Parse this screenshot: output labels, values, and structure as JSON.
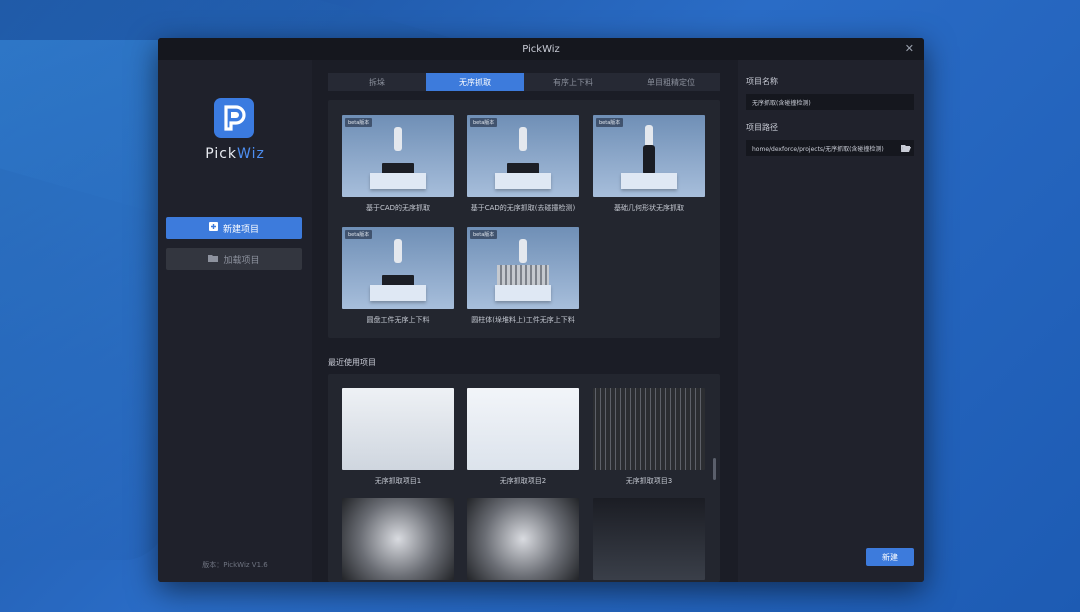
{
  "window": {
    "title": "PickWiz"
  },
  "sidebar": {
    "logo_prefix": "Pick",
    "logo_suffix": "Wiz",
    "new_project_label": "新建项目",
    "open_project_label": "加载项目",
    "version_label": "版本：PickWiz V1.6"
  },
  "tabs": [
    {
      "label": "拆垛",
      "active": false
    },
    {
      "label": "无序抓取",
      "active": true
    },
    {
      "label": "有序上下料",
      "active": false
    },
    {
      "label": "单目粗精定位",
      "active": false
    }
  ],
  "templates": [
    {
      "badge": "beta版本",
      "caption": "基于CAD的无序抓取"
    },
    {
      "badge": "beta版本",
      "caption": "基于CAD的无序抓取(去碰撞检测)"
    },
    {
      "badge": "beta版本",
      "caption": "基础几何形状无序抓取"
    },
    {
      "badge": "beta版本",
      "caption": "圆盘工件无序上下料"
    },
    {
      "badge": "beta版本",
      "caption": "圆柱体(垛堆料上)工件无序上下料"
    }
  ],
  "recent": {
    "title": "最近使用项目",
    "items": [
      {
        "caption": "无序抓取项目1"
      },
      {
        "caption": "无序抓取项目2"
      },
      {
        "caption": "无序抓取项目3"
      },
      {
        "caption": ""
      },
      {
        "caption": ""
      },
      {
        "caption": ""
      }
    ]
  },
  "form": {
    "name_label": "项目名称",
    "name_value": "无序抓取(含碰撞检测)",
    "path_label": "项目路径",
    "path_value": "home/dexforce/projects/无序抓取(含碰撞检测)",
    "create_label": "新建"
  },
  "colors": {
    "accent": "#3d7bdc",
    "window_bg": "#1b1d26",
    "panel_bg": "#23262f"
  }
}
